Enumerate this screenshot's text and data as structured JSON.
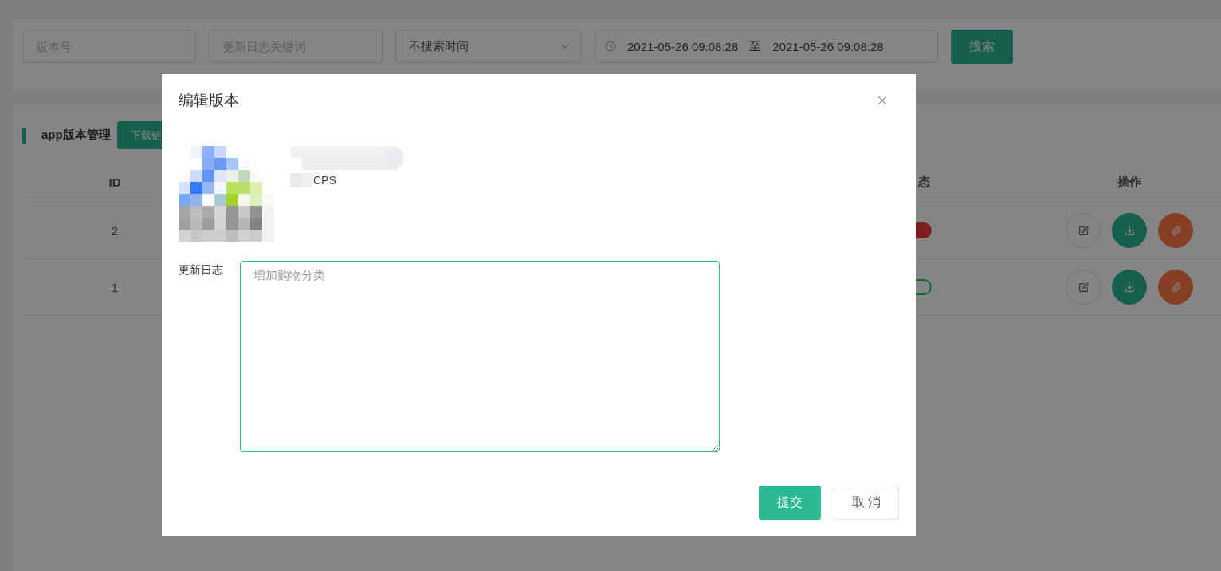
{
  "filters": {
    "version": {
      "placeholder": "版本号"
    },
    "keyword": {
      "placeholder": "更新日志关键词"
    },
    "time_mode": "不搜索时间",
    "date_range": {
      "start": "2021-05-26 09:08:28",
      "separator": "至",
      "end": "2021-05-26 09:08:28"
    },
    "search_button": "搜索"
  },
  "table_card": {
    "title": "app版本管理",
    "action_button": "下载链",
    "columns": [
      "ID",
      "态",
      "操作"
    ],
    "rows": [
      {
        "id": "2",
        "on": false
      },
      {
        "id": "1",
        "on": true
      }
    ]
  },
  "dialog": {
    "title": "编辑版本",
    "app_name_suffix": "CPS",
    "changelog_label": "更新日志",
    "changelog": {
      "placeholder": "增加购物分类"
    },
    "buttons": [
      {
        "label": "提交",
        "kind": "primary"
      },
      {
        "label": "取 消",
        "kind": "default"
      }
    ]
  }
}
